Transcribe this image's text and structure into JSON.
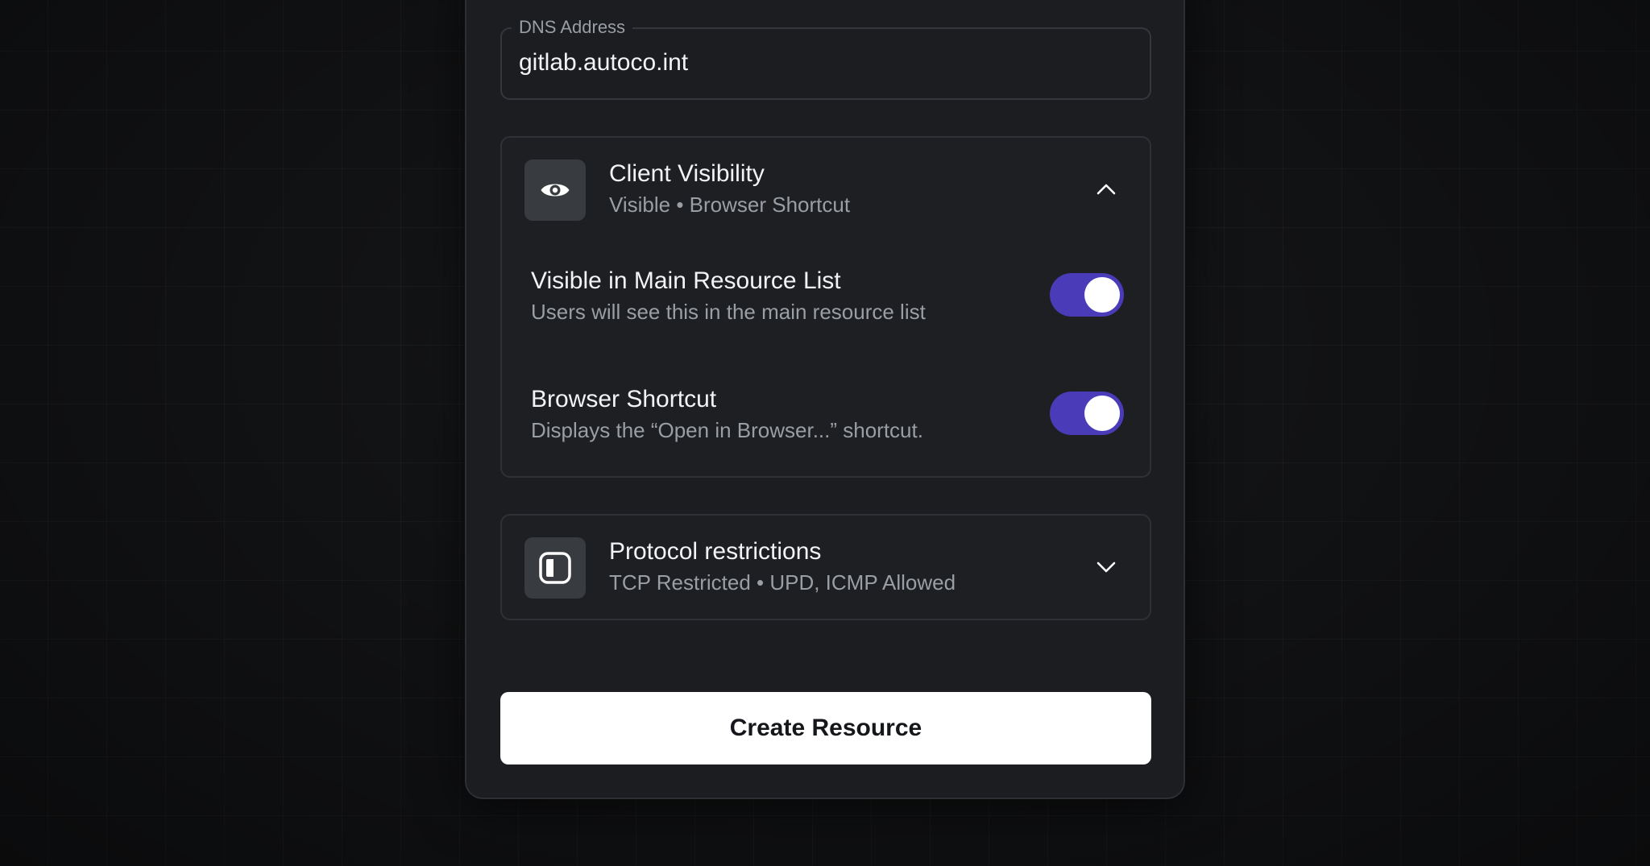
{
  "dns_field": {
    "label": "DNS Address",
    "value": "gitlab.autoco.int"
  },
  "client_visibility": {
    "icon": "eye-icon",
    "title": "Client Visibility",
    "subtitle": "Visible • Browser Shortcut",
    "expanded": true,
    "options": [
      {
        "title": "Visible in Main Resource List",
        "description": "Users will see this in the main resource list",
        "enabled": true
      },
      {
        "title": "Browser Shortcut",
        "description": "Displays the “Open in Browser...” shortcut.",
        "enabled": true
      }
    ]
  },
  "protocol_restrictions": {
    "icon": "shield-half-icon",
    "title": "Protocol restrictions",
    "subtitle": "TCP Restricted • UPD, ICMP Allowed",
    "expanded": false
  },
  "create_button": {
    "label": "Create Resource"
  },
  "colors": {
    "toggle_on": "#4a3bb8",
    "modal_bg": "#1b1d20",
    "button_bg": "#ffffff"
  }
}
